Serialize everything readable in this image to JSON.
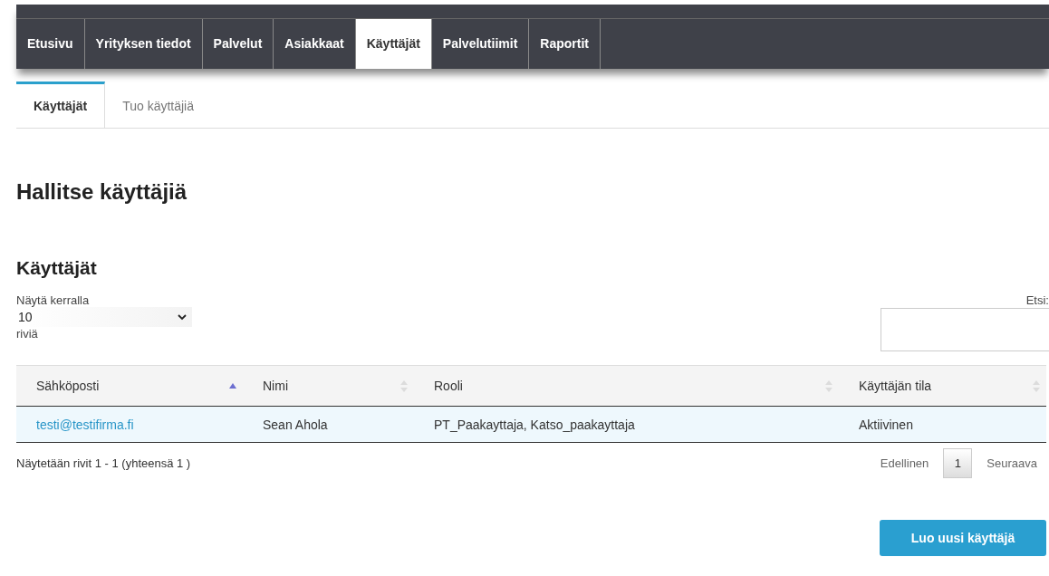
{
  "nav_tabs": [
    {
      "label": "Etusivu",
      "selected": false
    },
    {
      "label": "Yrityksen tiedot",
      "selected": false
    },
    {
      "label": "Palvelut",
      "selected": false
    },
    {
      "label": "Asiakkaat",
      "selected": false
    },
    {
      "label": "Käyttäjät",
      "selected": true
    },
    {
      "label": "Palvelutiimit",
      "selected": false
    },
    {
      "label": "Raportit",
      "selected": false
    }
  ],
  "sub_tabs": [
    {
      "label": "Käyttäjät",
      "selected": true
    },
    {
      "label": "Tuo käyttäjiä",
      "selected": false
    }
  ],
  "page_title": "Hallitse käyttäjiä",
  "section_title": "Käyttäjät",
  "length_control": {
    "label": "Näytä kerralla",
    "value": "10",
    "suffix": "riviä"
  },
  "search": {
    "label": "Etsi:"
  },
  "table": {
    "columns": [
      {
        "label": "Sähköposti",
        "sorted": true
      },
      {
        "label": "Nimi",
        "sorted": false
      },
      {
        "label": "Rooli",
        "sorted": false
      },
      {
        "label": "Käyttäjän tila",
        "sorted": false
      }
    ],
    "rows": [
      {
        "cells": [
          "testi@testifirma.fi",
          "Sean Ahola",
          "PT_Paakayttaja, Katso_paakayttaja",
          "Aktiivinen"
        ]
      }
    ]
  },
  "info": "Näytetään rivit 1 - 1 (yhteensä 1 )",
  "pagination": {
    "previous": "Edellinen",
    "pages": [
      "1"
    ],
    "next": "Seuraava"
  },
  "create_button": "Luo uusi käyttäjä"
}
